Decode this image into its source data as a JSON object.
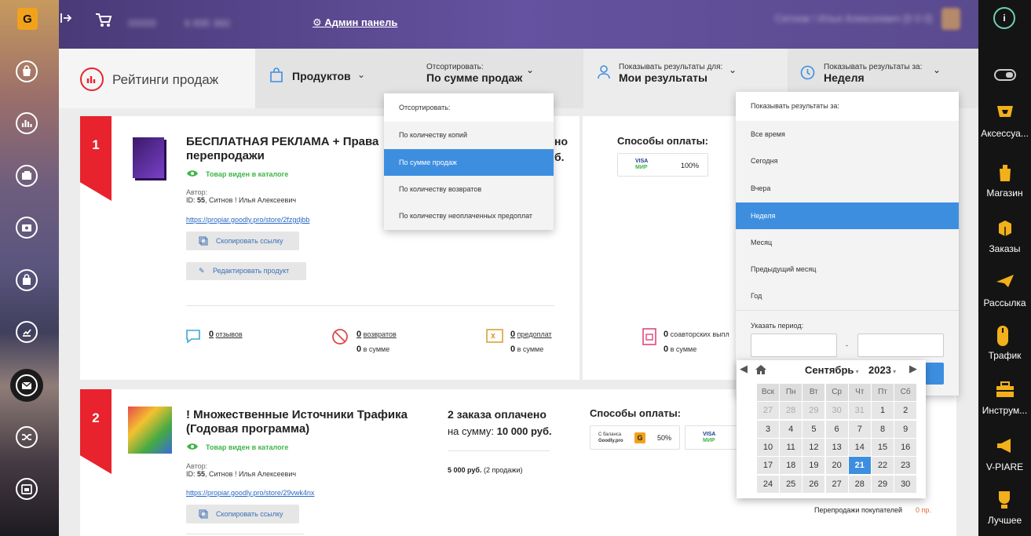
{
  "app": {
    "logo_letter": "G"
  },
  "topbar": {
    "admin_label": "Админ панель",
    "blur_left": "00000",
    "blur_phone": "6 895 360",
    "blur_user": "Ситнов ! Илья Алексеевич [0 0 0]"
  },
  "filters": {
    "ratings_title": "Рейтинги продаж",
    "products_label": "Продуктов",
    "sort_caption": "Отсортировать:",
    "sort_value": "По сумме продаж",
    "show_for_caption": "Показывать результаты для:",
    "show_for_value": "Мои результаты",
    "period_caption": "Показывать результаты за:",
    "period_value": "Неделя"
  },
  "sort_dropdown": {
    "header": "Отсортировать:",
    "items": [
      "По количеству копий",
      "По сумме продаж",
      "По количеству возвратов",
      "По количеству неоплаченных предоплат"
    ],
    "selected": 1
  },
  "period_dropdown": {
    "header": "Показывать результаты за:",
    "items": [
      "Все время",
      "Сегодня",
      "Вчера",
      "Неделя",
      "Месяц",
      "Предыдущий месяц",
      "Год"
    ],
    "selected": 3,
    "range_label": "Указать период:",
    "range_sep": "-"
  },
  "calendar": {
    "month": "Сентябрь",
    "year": "2023",
    "weekdays": [
      "Вск",
      "Пн",
      "Вт",
      "Ср",
      "Чт",
      "Пт",
      "Сб"
    ],
    "weeks": [
      [
        "27",
        "28",
        "29",
        "30",
        "31",
        "1",
        "2"
      ],
      [
        "3",
        "4",
        "5",
        "6",
        "7",
        "8",
        "9"
      ],
      [
        "10",
        "11",
        "12",
        "13",
        "14",
        "15",
        "16"
      ],
      [
        "17",
        "18",
        "19",
        "20",
        "21",
        "22",
        "23"
      ],
      [
        "24",
        "25",
        "26",
        "27",
        "28",
        "29",
        "30"
      ]
    ],
    "today": "21"
  },
  "products": [
    {
      "rank": "1",
      "title_line1": "БЕСПЛАТНАЯ РЕКЛАМА + Права",
      "title_line2": "перепродажи",
      "visible_label": "Товар виден в каталоге",
      "author_caption": "Автор:",
      "author_id_prefix": "ID: ",
      "author_id": "55",
      "author_name": ", Ситнов ! Илья Алексеевич",
      "link": "https://propiar.goodly.pro/store/2fzgdjbb",
      "copy_label": "Скопировать ссылку",
      "edit_label": "Редактировать продукт",
      "partial_sales_1": "но",
      "partial_sales_2": "б.",
      "payments_title": "Способы оплаты:",
      "payment_pct": "100%",
      "reviews_count": "0",
      "reviews_label": "отзывов",
      "returns_count": "0",
      "returns_label": "возвратов",
      "returns_sum_count": "0",
      "returns_sum_label": "в сумме",
      "prepay_count": "0",
      "prepay_label": "предоплат",
      "prepay_sum_count": "0",
      "prepay_sum_label": "в сумме",
      "coauthor_count": "0",
      "coauthor_label": "соавторских выпл",
      "coauthor_sum_count": "0",
      "coauthor_sum_label": "в сумме"
    },
    {
      "rank": "2",
      "title_line1": "! Множественные Источники Трафика",
      "title_line2": "(Годовая программа)",
      "visible_label": "Товар виден в каталоге",
      "author_caption": "Автор:",
      "author_id_prefix": "ID: ",
      "author_id": "55",
      "author_name": ", Ситнов ! Илья Алексеевич",
      "link": "https://propiar.goodly.pro/store/29vwk4nx",
      "copy_label": "Скопировать ссылку",
      "orders_title": "2 заказа оплачено",
      "sum_prefix": "на сумму: ",
      "sum_value": "10 000 руб.",
      "breakdown_value": "5 000 руб.",
      "breakdown_note": " (2 продажи)",
      "payments_title": "Способы оплаты:",
      "balance_line1": "С баланса",
      "balance_line2": "Goodly.pro",
      "balance_pct": "50%",
      "resale_label": "Перепродажи покупателей",
      "resale_value": "0 пр."
    }
  ],
  "right_sidebar": {
    "items": [
      "Аксессуа...",
      "Магазин",
      "Заказы",
      "Рассылка",
      "Трафик",
      "Инструм...",
      "V-PIARE",
      "Лучшее"
    ]
  },
  "colors": {
    "accent": "#3e8ee0",
    "rank": "#e8232d",
    "green": "#3eb549",
    "top_bar": "#5a4a8e"
  }
}
